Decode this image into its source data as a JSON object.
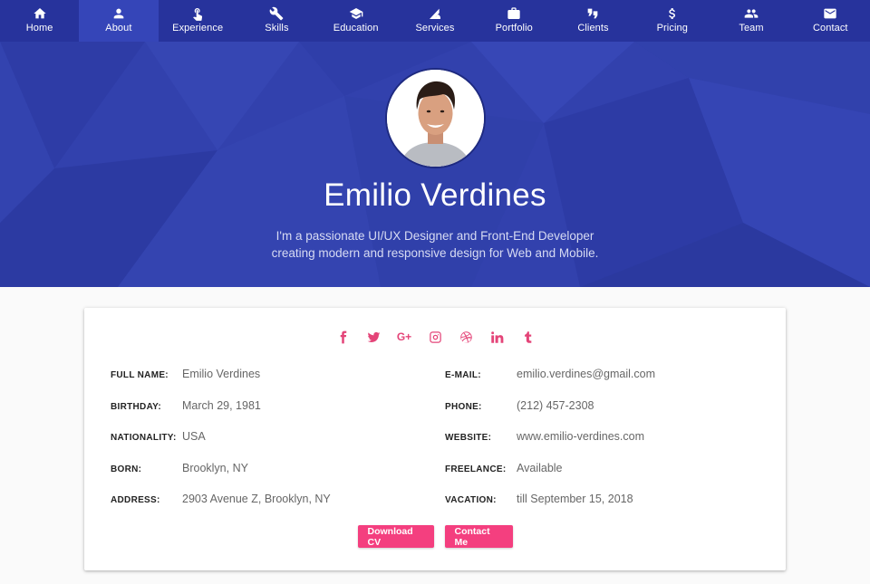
{
  "nav": {
    "items": [
      {
        "label": "Home",
        "icon": "home-icon"
      },
      {
        "label": "About",
        "icon": "person-icon",
        "active": true
      },
      {
        "label": "Experience",
        "icon": "touch-icon"
      },
      {
        "label": "Skills",
        "icon": "wrench-icon"
      },
      {
        "label": "Education",
        "icon": "mortarboard-icon"
      },
      {
        "label": "Services",
        "icon": "services-icon"
      },
      {
        "label": "Portfolio",
        "icon": "briefcase-icon"
      },
      {
        "label": "Clients",
        "icon": "handshake-icon"
      },
      {
        "label": "Pricing",
        "icon": "dollar-icon"
      },
      {
        "label": "Team",
        "icon": "group-icon"
      },
      {
        "label": "Contact",
        "icon": "envelope-icon"
      }
    ]
  },
  "hero": {
    "name": "Emilio Verdines",
    "bio": "I'm a passionate UI/UX Designer and Front-End Developer creating modern and responsive design for Web and Mobile."
  },
  "social": [
    "facebook-icon",
    "twitter-icon",
    "google-plus-icon",
    "instagram-icon",
    "dribbble-icon",
    "linkedin-icon",
    "tumblr-icon"
  ],
  "social_gplus_text": "G+",
  "info": {
    "left": [
      {
        "label": "FULL NAME:",
        "value": "Emilio Verdines"
      },
      {
        "label": "BIRTHDAY:",
        "value": "March 29, 1981"
      },
      {
        "label": "NATIONALITY:",
        "value": "USA"
      },
      {
        "label": "BORN:",
        "value": "Brooklyn, NY"
      },
      {
        "label": "ADDRESS:",
        "value": "2903 Avenue Z, Brooklyn, NY"
      }
    ],
    "right": [
      {
        "label": "E-MAIL:",
        "value": "emilio.verdines@gmail.com"
      },
      {
        "label": "PHONE:",
        "value": "(212) 457-2308"
      },
      {
        "label": "WEBSITE:",
        "value": "www.emilio-verdines.com"
      },
      {
        "label": "FREELANCE:",
        "value": "Available"
      },
      {
        "label": "VACATION:",
        "value": "till September 15, 2018"
      }
    ]
  },
  "buttons": {
    "download": "Download CV",
    "contact": "Contact Me"
  },
  "colors": {
    "nav_bg": "#27339c",
    "nav_active": "#3545b8",
    "hero_bg": "#3241ad",
    "accent": "#f43f7f",
    "social": "#e44478"
  }
}
